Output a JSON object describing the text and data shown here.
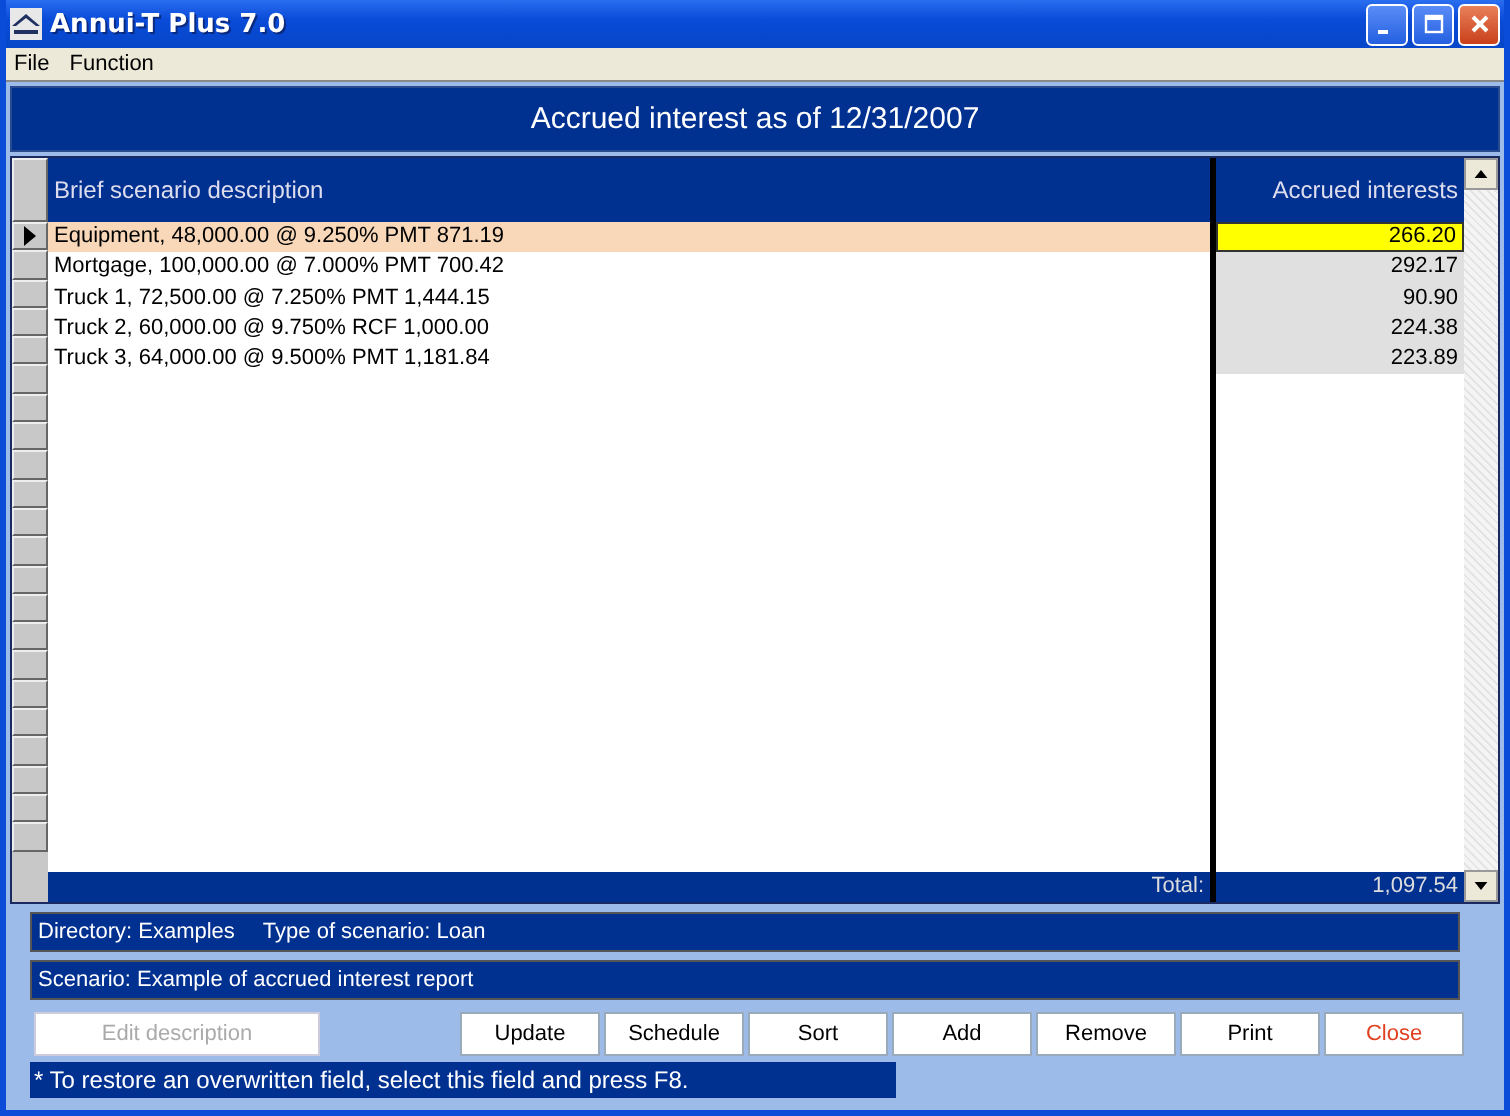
{
  "window": {
    "title": "Annui-T Plus 7.0"
  },
  "menu": [
    "File",
    "Function"
  ],
  "heading": "Accrued interest as of 12/31/2007",
  "table": {
    "columns": [
      "Brief scenario description",
      "Accrued interests"
    ],
    "rows": [
      {
        "description": "Equipment, 48,000.00 @ 9.250% PMT 871.19",
        "interest": "266.20",
        "selected": true
      },
      {
        "description": "Mortgage, 100,000.00 @ 7.000% PMT 700.42",
        "interest": "292.17",
        "selected": false
      },
      {
        "description": "Truck 1, 72,500.00 @ 7.250% PMT 1,444.15",
        "interest": "90.90",
        "selected": false
      },
      {
        "description": "Truck 2, 60,000.00 @ 9.750% RCF 1,000.00",
        "interest": "224.38",
        "selected": false
      },
      {
        "description": "Truck 3, 64,000.00 @ 9.500% PMT 1,181.84",
        "interest": "223.89",
        "selected": false
      }
    ],
    "total_label": "Total:",
    "total": "1,097.54"
  },
  "info": {
    "directory": "Directory: Examples",
    "scenario_type": "Type of scenario: Loan",
    "scenario": "Scenario: Example of accrued interest report"
  },
  "buttons": [
    {
      "label": "Edit description",
      "kind": "normal",
      "disabled": true
    },
    {
      "label": "Update",
      "kind": "normal",
      "disabled": false
    },
    {
      "label": "Schedule",
      "kind": "normal",
      "disabled": false
    },
    {
      "label": "Sort",
      "kind": "normal",
      "disabled": false
    },
    {
      "label": "Add",
      "kind": "normal",
      "disabled": false
    },
    {
      "label": "Remove",
      "kind": "normal",
      "disabled": false
    },
    {
      "label": "Print",
      "kind": "normal",
      "disabled": false
    },
    {
      "label": "Close",
      "kind": "close",
      "disabled": false
    }
  ],
  "note": "* To restore an overwritten field, select this field and press F8."
}
